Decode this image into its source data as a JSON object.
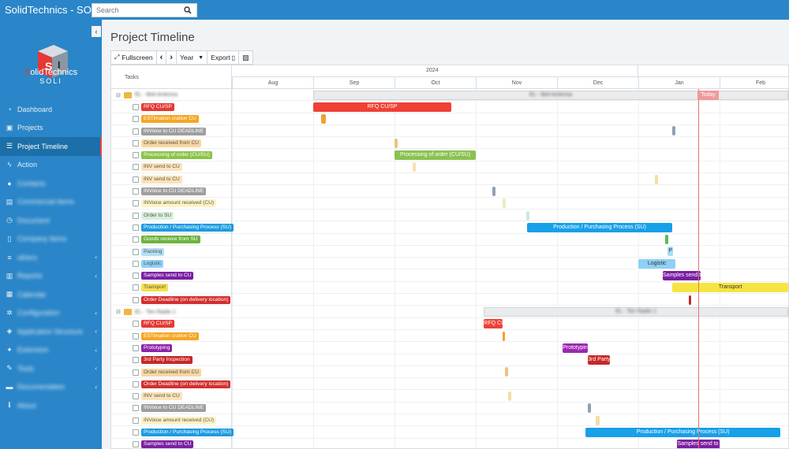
{
  "app": {
    "title": "SolidTechnics - SOLI"
  },
  "search": {
    "placeholder": "Search"
  },
  "logo": {
    "line1a": "S",
    "line1b": "olidTechnics",
    "line2": "SOLI"
  },
  "sidebar": {
    "items": [
      {
        "label": "Dashboard",
        "icon": "dashboard-icon",
        "glyph": "◔",
        "active": false,
        "blur": false,
        "chevron": false
      },
      {
        "label": "Projects",
        "icon": "projects-icon",
        "glyph": "▣",
        "active": false,
        "blur": false,
        "chevron": false
      },
      {
        "label": "Project Timeline",
        "icon": "timeline-icon",
        "glyph": "☰",
        "active": true,
        "blur": false,
        "chevron": false
      },
      {
        "label": "Action",
        "icon": "bolt-icon",
        "glyph": "ϟ",
        "active": false,
        "blur": false,
        "chevron": false
      },
      {
        "label": "Contacts",
        "icon": "user-icon",
        "glyph": "●",
        "active": false,
        "blur": true,
        "chevron": false
      },
      {
        "label": "Commercial items",
        "icon": "cart-icon",
        "glyph": "▤",
        "active": false,
        "blur": true,
        "chevron": false
      },
      {
        "label": "Document",
        "icon": "clock-icon",
        "glyph": "◷",
        "active": false,
        "blur": true,
        "chevron": false
      },
      {
        "label": "Company items",
        "icon": "file-icon",
        "glyph": "▯",
        "active": false,
        "blur": true,
        "chevron": false
      },
      {
        "label": "others",
        "icon": "list-icon",
        "glyph": "≡",
        "active": false,
        "blur": true,
        "chevron": true
      },
      {
        "label": "Reports",
        "icon": "chart-icon",
        "glyph": "▥",
        "active": false,
        "blur": true,
        "chevron": true
      },
      {
        "label": "Calendar",
        "icon": "calendar-icon",
        "glyph": "▦",
        "active": false,
        "blur": true,
        "chevron": false
      },
      {
        "label": "Configuration",
        "icon": "gear-icon",
        "glyph": "✲",
        "active": false,
        "blur": true,
        "chevron": true
      },
      {
        "label": "Application Structure",
        "icon": "layers-icon",
        "glyph": "◈",
        "active": false,
        "blur": true,
        "chevron": true
      },
      {
        "label": "Extension",
        "icon": "puzzle-icon",
        "glyph": "✦",
        "active": false,
        "blur": true,
        "chevron": true
      },
      {
        "label": "Tools",
        "icon": "wrench-icon",
        "glyph": "✎",
        "active": false,
        "blur": true,
        "chevron": true
      },
      {
        "label": "Documentation",
        "icon": "book-icon",
        "glyph": "▬",
        "active": false,
        "blur": true,
        "chevron": true
      },
      {
        "label": "About",
        "icon": "info-icon",
        "glyph": "ℹ",
        "active": false,
        "blur": true,
        "chevron": false
      }
    ]
  },
  "page": {
    "title": "Project Timeline"
  },
  "toolbar": {
    "fullscreen": "Fullscreen",
    "prev": "‹",
    "next": "›",
    "scale": "Year",
    "export": "Export"
  },
  "gantt": {
    "tasks_header": "Tasks",
    "year_left": "2024",
    "months": [
      "Aug",
      "Sep",
      "Oct",
      "Nov",
      "Dec",
      "Jan",
      "Feb"
    ],
    "today_label": "Today",
    "rows": [
      {
        "type": "group",
        "label": "EL - Bell Antenna",
        "bar": {
          "label": "EL - Bell Antenna",
          "start": 1.0,
          "end": 7.0
        }
      },
      {
        "type": "task",
        "label": "RFQ CU/SP",
        "pill_bg": "#e53935",
        "pill_fg": "#ffffff",
        "bar": {
          "label": "RFQ CU/SP",
          "start": 1.0,
          "end": 2.7,
          "color": "#ef4136"
        }
      },
      {
        "type": "task",
        "label": "ESTimation cration CU",
        "pill_bg": "#f5a623",
        "pill_fg": "#ffffff",
        "bar": {
          "label": "",
          "start": 1.1,
          "end": 1.16,
          "color": "#f0a030"
        }
      },
      {
        "type": "task",
        "label": "INVoice to CU DEADLINE",
        "pill_bg": "#9e9e9e",
        "pill_fg": "#ffffff",
        "bar": {
          "label": "",
          "start": 5.42,
          "end": 5.46,
          "color": "#90a0b0"
        }
      },
      {
        "type": "task",
        "label": "Order received from CU",
        "pill_bg": "#f8d7a0",
        "pill_fg": "#555555",
        "bar": {
          "label": "",
          "start": 2.0,
          "end": 2.04,
          "color": "#f0c080"
        }
      },
      {
        "type": "task",
        "label": "Processing of order (CU/SU)",
        "pill_bg": "#8bc34a",
        "pill_fg": "#ffffff",
        "bar": {
          "label": "Processing of order (CU/SU)",
          "start": 2.0,
          "end": 3.0,
          "color": "#8cc152"
        }
      },
      {
        "type": "task",
        "label": "INV send to CU",
        "pill_bg": "#fbe3b8",
        "pill_fg": "#555555",
        "bar": {
          "label": "",
          "start": 2.22,
          "end": 2.26,
          "color": "#f8e0b0"
        }
      },
      {
        "type": "task",
        "label": "INV send to CU",
        "pill_bg": "#fbe3b8",
        "pill_fg": "#555555",
        "bar": {
          "label": "",
          "start": 5.2,
          "end": 5.24,
          "color": "#f0e0a0"
        }
      },
      {
        "type": "task",
        "label": "INVoice to CU DEADLINE",
        "pill_bg": "#9e9e9e",
        "pill_fg": "#ffffff",
        "bar": {
          "label": "",
          "start": 3.2,
          "end": 3.24,
          "color": "#90a0b0"
        }
      },
      {
        "type": "task",
        "label": "INVoice amount received (CU)",
        "pill_bg": "#fff3c4",
        "pill_fg": "#555555",
        "bar": {
          "label": "",
          "start": 3.33,
          "end": 3.37,
          "color": "#e0f0c0"
        }
      },
      {
        "type": "task",
        "label": "Order to SU",
        "pill_bg": "#d7f0dc",
        "pill_fg": "#555555",
        "bar": {
          "label": "",
          "start": 3.62,
          "end": 3.66,
          "color": "#c8ecd8"
        }
      },
      {
        "type": "task",
        "label": "Production / Purchasing Process (SU)",
        "pill_bg": "#1e9be0",
        "pill_fg": "#ffffff",
        "bar": {
          "label": "Production / Purchasing Process (SU)",
          "start": 3.63,
          "end": 5.42,
          "color": "#18a0e8"
        }
      },
      {
        "type": "task",
        "label": "Goods receive from SU",
        "pill_bg": "#6db33f",
        "pill_fg": "#ffffff",
        "bar": {
          "label": "",
          "start": 5.33,
          "end": 5.37,
          "color": "#5cb85c"
        }
      },
      {
        "type": "task",
        "label": "Packing",
        "pill_bg": "#b3e0f5",
        "pill_fg": "#555555",
        "bar": {
          "label": "P",
          "start": 5.36,
          "end": 5.43,
          "color": "#a8dcf5"
        }
      },
      {
        "type": "task",
        "label": "Logistic",
        "pill_bg": "#90d0f5",
        "pill_fg": "#555555",
        "bar": {
          "label": "Logistic",
          "start": 5.0,
          "end": 5.46,
          "color": "#8fd0f5"
        }
      },
      {
        "type": "task",
        "label": "Samples send to CU",
        "pill_bg": "#7b1fa2",
        "pill_fg": "#ffffff",
        "bar": {
          "label": "Samples send to CU",
          "start": 5.3,
          "end": 5.77,
          "color": "#7b1fa2"
        }
      },
      {
        "type": "task",
        "label": "Transport",
        "pill_bg": "#f4e04d",
        "pill_fg": "#555555",
        "bar": {
          "label": "Transport",
          "start": 5.42,
          "end": 6.87,
          "color": "#f5e542"
        }
      },
      {
        "type": "task",
        "label": "Order Deadline (on delivery location)",
        "pill_bg": "#d32f2f",
        "pill_fg": "#ffffff",
        "bar": {
          "label": "",
          "start": 5.62,
          "end": 5.65,
          "color": "#c62828"
        }
      },
      {
        "type": "group",
        "label": "EL - Ten Radio 1",
        "bar": {
          "label": "EL - Ten Radio 1",
          "start": 3.1,
          "end": 7.0
        }
      },
      {
        "type": "task",
        "label": "RFQ CU/SP",
        "pill_bg": "#e53935",
        "pill_fg": "#ffffff",
        "bar": {
          "label": "RFQ CU/SP",
          "start": 3.1,
          "end": 3.33,
          "color": "#ef4136"
        }
      },
      {
        "type": "task",
        "label": "ESTimation cration CU",
        "pill_bg": "#f5a623",
        "pill_fg": "#ffffff",
        "bar": {
          "label": "",
          "start": 3.33,
          "end": 3.36,
          "color": "#f0a030"
        }
      },
      {
        "type": "task",
        "label": "Prototyping",
        "pill_bg": "#8e24aa",
        "pill_fg": "#ffffff",
        "bar": {
          "label": "Prototyping",
          "start": 4.07,
          "end": 4.38,
          "color": "#9c27b0"
        }
      },
      {
        "type": "task",
        "label": "3rd Party Inspection",
        "pill_bg": "#c62828",
        "pill_fg": "#ffffff",
        "bar": {
          "label": "3rd Party Inspection",
          "start": 4.38,
          "end": 4.65,
          "color": "#c62828"
        }
      },
      {
        "type": "task",
        "label": "Order received from CU",
        "pill_bg": "#f8d7a0",
        "pill_fg": "#555555",
        "bar": {
          "label": "",
          "start": 3.36,
          "end": 3.4,
          "color": "#f0c080"
        }
      },
      {
        "type": "task",
        "label": "Order Deadline (on delivery location)",
        "pill_bg": "#d32f2f",
        "pill_fg": "#ffffff",
        "bar": {
          "label": "",
          "start": 0,
          "end": 0,
          "color": "#c62828"
        }
      },
      {
        "type": "task",
        "label": "INV send to CU",
        "pill_bg": "#fbe3b8",
        "pill_fg": "#555555",
        "bar": {
          "label": "",
          "start": 3.4,
          "end": 3.44,
          "color": "#f0e0a0"
        }
      },
      {
        "type": "task",
        "label": "INVoice to CU DEADLINE",
        "pill_bg": "#9e9e9e",
        "pill_fg": "#ffffff",
        "bar": {
          "label": "",
          "start": 4.38,
          "end": 4.42,
          "color": "#90a0b0"
        }
      },
      {
        "type": "task",
        "label": "INVoice amount received (CU)",
        "pill_bg": "#fff3c4",
        "pill_fg": "#555555",
        "bar": {
          "label": "",
          "start": 4.48,
          "end": 4.52,
          "color": "#f0e0a0"
        }
      },
      {
        "type": "task",
        "label": "Production / Purchasing Process (SU)",
        "pill_bg": "#1e9be0",
        "pill_fg": "#ffffff",
        "bar": {
          "label": "Production / Purchasing Process (SU)",
          "start": 4.35,
          "end": 6.75,
          "color": "#18a0e8"
        }
      },
      {
        "type": "task",
        "label": "Samples send to CU",
        "pill_bg": "#7b1fa2",
        "pill_fg": "#ffffff",
        "bar": {
          "label": "Samples send to CU",
          "start": 5.48,
          "end": 6.0,
          "color": "#7b1fa2"
        }
      }
    ],
    "today_position": 5.74
  }
}
